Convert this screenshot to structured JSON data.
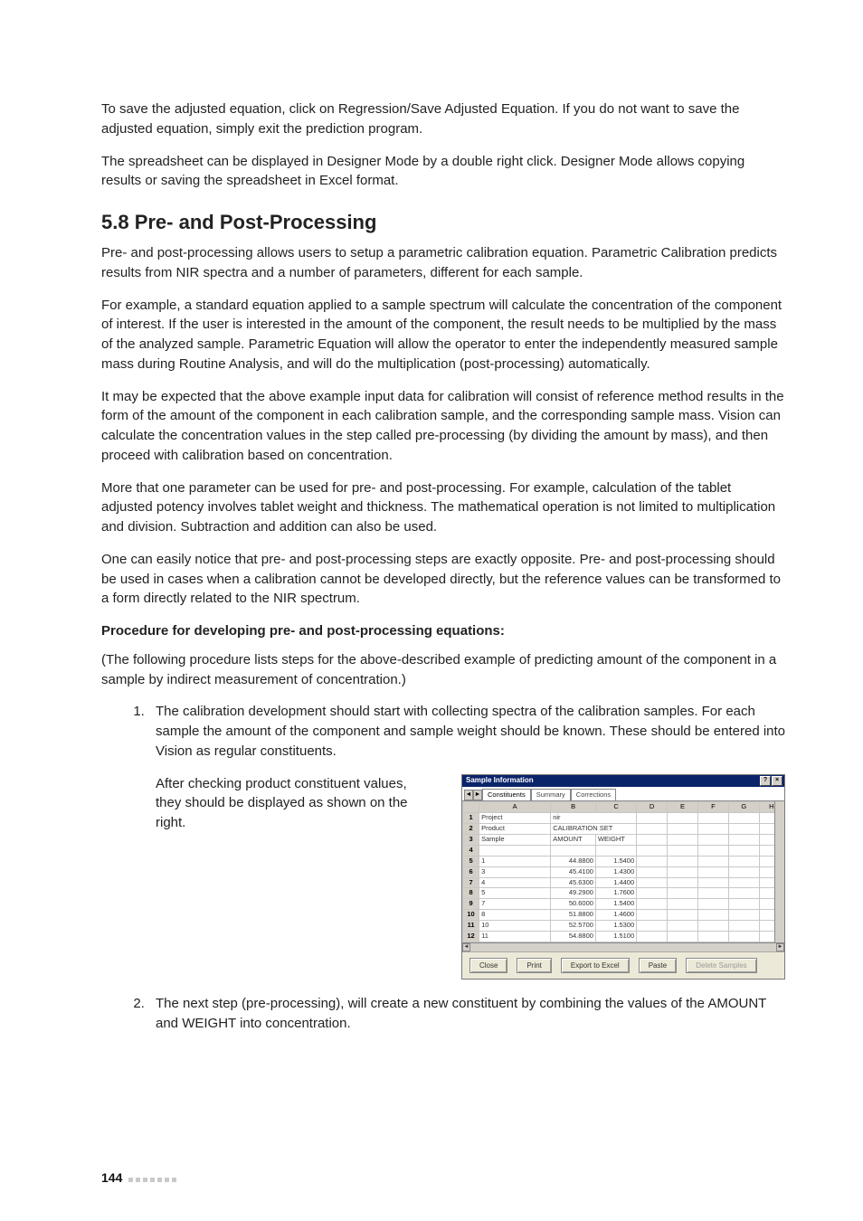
{
  "para1": "To save the adjusted equation, click on Regression/Save Adjusted Equation. If you do not want to save the adjusted equation, simply exit the prediction program.",
  "para2": "The spreadsheet can be displayed in Designer Mode by a double right click. Designer Mode allows copying results or saving the spreadsheet in Excel format.",
  "heading": "5.8   Pre- and Post-Processing",
  "para3": "Pre- and post-processing allows users to setup a parametric calibration equation. Parametric Calibration predicts results from NIR spectra and a number of parameters, different for each sample.",
  "para4": "For example, a standard equation applied to a sample spectrum will calculate the concentration of the component of interest. If the user is interested in the amount of the component, the result needs to be multiplied by the mass of the analyzed sample. Parametric Equation will allow the operator to enter the independently measured sample mass during Routine Analysis, and will do the multiplication (post-processing) automatically.",
  "para5": "It may be expected that the above example input data for calibration will consist of reference method results in the form of the amount of the component in each calibration sample, and the corresponding sample mass. Vision can calculate the concentration values in the step called pre-processing (by dividing the amount by mass), and then proceed with calibration based on concentration.",
  "para6": "More that one parameter can be used for pre- and post-processing. For example, calculation of the tablet adjusted potency involves tablet weight and thickness. The mathematical operation is not limited to multiplication and division. Subtraction and addition can also be used.",
  "para7": "One can easily notice that pre- and post-processing steps are exactly opposite. Pre- and post-processing should be used in cases when a calibration cannot be developed directly, but the reference values can be transformed to a form directly related to the NIR spectrum.",
  "procHeading": "Procedure for developing pre- and post-processing equations:",
  "procIntro": "(The following procedure lists steps for the above-described example of predicting amount of the component in a sample by indirect measurement of concentration.)",
  "step1": "The calibration development should start with collecting spectra of the calibration samples. For each sample the amount of the component and sample weight should be known. These should be entered into Vision as regular constituents.",
  "step1b": "After checking product constituent values, they should be displayed as shown on the right.",
  "step2": "The next step (pre-processing), will create a new constituent by combining the values of  the AMOUNT and WEIGHT into concentration.",
  "pageNum": "144",
  "win": {
    "title": "Sample Information",
    "tabs": [
      "Constituents",
      "Summary",
      "Corrections"
    ],
    "cols": [
      "A",
      "B",
      "C",
      "D",
      "E",
      "F",
      "G",
      "H"
    ],
    "rows": [
      {
        "n": "1",
        "a": "Project",
        "b": "nir",
        "c": ""
      },
      {
        "n": "2",
        "a": "Product",
        "b": "CALIBRATION SET",
        "c": ""
      },
      {
        "n": "3",
        "a": "Sample",
        "b": "AMOUNT",
        "c": "WEIGHT"
      },
      {
        "n": "4",
        "a": "",
        "b": "",
        "c": ""
      },
      {
        "n": "5",
        "a": "1",
        "b": "44.8800",
        "c": "1.5400"
      },
      {
        "n": "6",
        "a": "3",
        "b": "45.4100",
        "c": "1.4300"
      },
      {
        "n": "7",
        "a": "4",
        "b": "45.6300",
        "c": "1.4400"
      },
      {
        "n": "8",
        "a": "5",
        "b": "49.2900",
        "c": "1.7600"
      },
      {
        "n": "9",
        "a": "7",
        "b": "50.6000",
        "c": "1.5400"
      },
      {
        "n": "10",
        "a": "8",
        "b": "51.8800",
        "c": "1.4600"
      },
      {
        "n": "11",
        "a": "10",
        "b": "52.5700",
        "c": "1.5300"
      },
      {
        "n": "12",
        "a": "11",
        "b": "54.8800",
        "c": "1.5100"
      }
    ],
    "buttons": {
      "close": "Close",
      "print": "Print",
      "export": "Export to Excel",
      "paste": "Paste",
      "delete": "Delete Samples"
    }
  }
}
